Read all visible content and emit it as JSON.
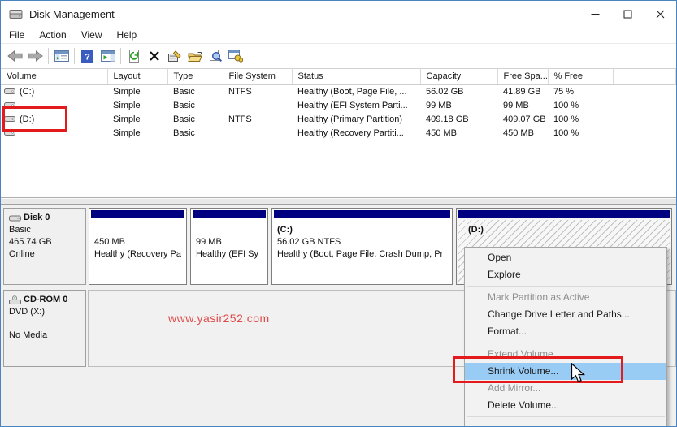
{
  "window": {
    "title": "Disk Management",
    "controls": [
      "minimize-icon",
      "maximize-icon",
      "close-icon"
    ]
  },
  "menu_bar": {
    "file": "File",
    "action": "Action",
    "view": "View",
    "help": "Help"
  },
  "toolbar": {
    "icons": [
      "back-icon",
      "forward-icon",
      "console-tree-icon",
      "help-icon",
      "action-pane-icon",
      "refresh-icon",
      "delete-icon",
      "properties-icon",
      "open-folder-icon",
      "find-icon",
      "settings-icon"
    ]
  },
  "volume_list": {
    "columns": {
      "volume": "Volume",
      "layout": "Layout",
      "type": "Type",
      "fs": "File System",
      "status": "Status",
      "capacity": "Capacity",
      "free": "Free Spa...",
      "pct": "% Free"
    },
    "rows": [
      {
        "volume": "(C:)",
        "layout": "Simple",
        "type": "Basic",
        "fs": "NTFS",
        "status": "Healthy (Boot, Page File, ...",
        "capacity": "56.02 GB",
        "free": "41.89 GB",
        "pct": "75 %"
      },
      {
        "volume": "",
        "layout": "Simple",
        "type": "Basic",
        "fs": "",
        "status": "Healthy (EFI System Parti...",
        "capacity": "99 MB",
        "free": "99 MB",
        "pct": "100 %"
      },
      {
        "volume": "(D:)",
        "layout": "Simple",
        "type": "Basic",
        "fs": "NTFS",
        "status": "Healthy (Primary Partition)",
        "capacity": "409.18 GB",
        "free": "409.07 GB",
        "pct": "100 %"
      },
      {
        "volume": "",
        "layout": "Simple",
        "type": "Basic",
        "fs": "",
        "status": "Healthy (Recovery Partiti...",
        "capacity": "450 MB",
        "free": "450 MB",
        "pct": "100 %"
      }
    ]
  },
  "graph": {
    "disk0": {
      "name": "Disk 0",
      "type": "Basic",
      "size": "465.74 GB",
      "state": "Online",
      "partitions": [
        {
          "label": "",
          "size": "450 MB",
          "status": "Healthy (Recovery Pa"
        },
        {
          "label": "",
          "size": "99 MB",
          "status": "Healthy (EFI Sy"
        },
        {
          "label": "(C:)",
          "size": "56.02 GB NTFS",
          "status": "Healthy (Boot, Page File, Crash Dump, Pr"
        },
        {
          "label": "(D:)"
        }
      ]
    },
    "cdrom": {
      "name": "CD-ROM 0",
      "type": "DVD (X:)",
      "media": "No Media"
    }
  },
  "context_menu": {
    "open": "Open",
    "explore": "Explore",
    "mark_active": "Mark Partition as Active",
    "change_letter": "Change Drive Letter and Paths...",
    "format": "Format...",
    "extend": "Extend Volume...",
    "shrink": "Shrink Volume...",
    "add_mirror": "Add Mirror...",
    "delete": "Delete Volume..."
  },
  "watermark": {
    "text": "www.yasir252.com",
    "color": "#de4a49"
  },
  "colors": {
    "partition_band": "#000080",
    "menu_highlight": "#99ccf5",
    "annotation_red": "#e31b1c",
    "window_border": "#4a84c0"
  }
}
